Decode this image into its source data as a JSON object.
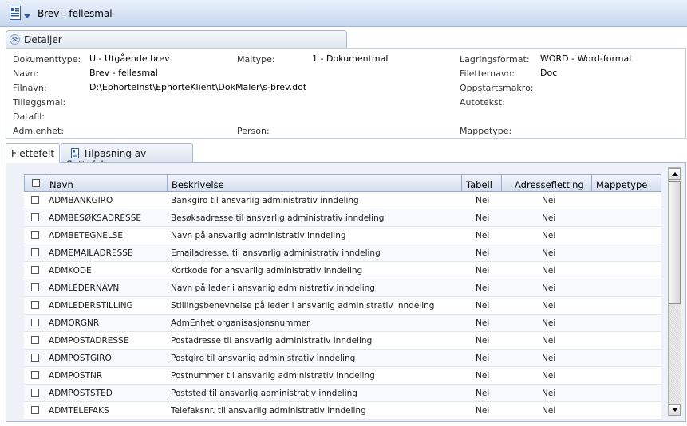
{
  "window": {
    "title": "Brev - fellesmal"
  },
  "details": {
    "section_label": "Detaljer",
    "labels": {
      "dokumenttype": "Dokumenttype:",
      "navn": "Navn:",
      "filnavn": "Filnavn:",
      "tilleggsmal": "Tilleggsmal:",
      "datafil": "Datafil:",
      "admenhet": "Adm.enhet:",
      "maltype": "Maltype:",
      "person": "Person:",
      "lagringsformat": "Lagringsformat:",
      "filetternavn": "Filetternavn:",
      "oppstartsmakro": "Oppstartsmakro:",
      "autotekst": "Autotekst:",
      "mappetype": "Mappetype:"
    },
    "values": {
      "dokumenttype": "U - Utgående brev",
      "navn": "Brev - fellesmal",
      "filnavn": "D:\\EphorteInst\\EphorteKlient\\DokMaler\\s-brev.dot",
      "maltype": "1 - Dokumentmal",
      "lagringsformat": "WORD - Word-format",
      "filetternavn": "Doc"
    }
  },
  "tabs": [
    {
      "label": "Flettefelt",
      "active": true
    },
    {
      "label": "Tilpasning av flettefelt",
      "active": false
    }
  ],
  "grid": {
    "columns": [
      "Navn",
      "Beskrivelse",
      "Tabell",
      "Adressefletting",
      "Mappetype"
    ],
    "rows": [
      {
        "navn": "ADMBANKGIRO",
        "beskrivelse": "Bankgiro til ansvarlig administrativ inndeling",
        "tabell": "Nei",
        "adressefletting": "Nei",
        "mappetype": ""
      },
      {
        "navn": "ADMBESØKSADRESSE",
        "beskrivelse": "Besøksadresse til ansvarlig administrativ inndeling",
        "tabell": "Nei",
        "adressefletting": "Nei",
        "mappetype": ""
      },
      {
        "navn": "ADMBETEGNELSE",
        "beskrivelse": "Navn på ansvarlig administrativ inndeling",
        "tabell": "Nei",
        "adressefletting": "Nei",
        "mappetype": ""
      },
      {
        "navn": "ADMEMAILADRESSE",
        "beskrivelse": "Emailadresse. til ansvarlig administrativ inndeling",
        "tabell": "Nei",
        "adressefletting": "Nei",
        "mappetype": ""
      },
      {
        "navn": "ADMKODE",
        "beskrivelse": "Kortkode for ansvarlig administrativ inndeling",
        "tabell": "Nei",
        "adressefletting": "Nei",
        "mappetype": ""
      },
      {
        "navn": "ADMLEDERNAVN",
        "beskrivelse": "Navn på leder i ansvarlig administrativ inndeling",
        "tabell": "Nei",
        "adressefletting": "Nei",
        "mappetype": ""
      },
      {
        "navn": "ADMLEDERSTILLING",
        "beskrivelse": "Stillingsbenevnelse på leder i ansvarlig administrativ inndeling",
        "tabell": "Nei",
        "adressefletting": "Nei",
        "mappetype": ""
      },
      {
        "navn": "ADMORGNR",
        "beskrivelse": "AdmEnhet organisasjonsnummer",
        "tabell": "Nei",
        "adressefletting": "Nei",
        "mappetype": ""
      },
      {
        "navn": "ADMPOSTADRESSE",
        "beskrivelse": "Postadresse til ansvarlig administrativ inndeling",
        "tabell": "Nei",
        "adressefletting": "Nei",
        "mappetype": ""
      },
      {
        "navn": "ADMPOSTGIRO",
        "beskrivelse": "Postgiro til ansvarlig administrativ inndeling",
        "tabell": "Nei",
        "adressefletting": "Nei",
        "mappetype": ""
      },
      {
        "navn": "ADMPOSTNR",
        "beskrivelse": "Postnummer til ansvarlig administrativ inndeling",
        "tabell": "Nei",
        "adressefletting": "Nei",
        "mappetype": ""
      },
      {
        "navn": "ADMPOSTSTED",
        "beskrivelse": "Poststed til ansvarlig administrativ inndeling",
        "tabell": "Nei",
        "adressefletting": "Nei",
        "mappetype": ""
      },
      {
        "navn": "ADMTELEFAKS",
        "beskrivelse": "Telefaksnr. til ansvarlig administrativ inndeling",
        "tabell": "Nei",
        "adressefletting": "Nei",
        "mappetype": ""
      }
    ]
  },
  "icons": {
    "app": "document-template-icon",
    "collapse": "collapse-chevron-icon",
    "tab2": "document-template-icon"
  }
}
